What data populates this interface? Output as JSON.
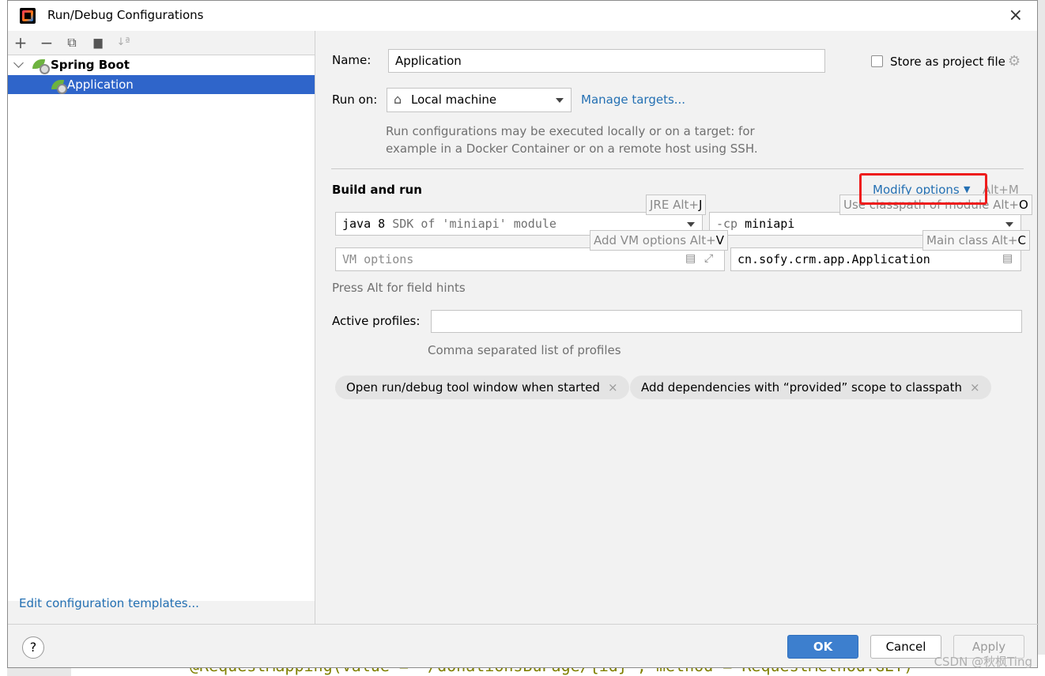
{
  "window": {
    "title": "Run/Debug Configurations",
    "close": "×"
  },
  "toolbar": {
    "add": "+",
    "remove": "−",
    "copy": "⧉",
    "folder": "▆",
    "sort": "↓ª"
  },
  "tree": {
    "group_label": "Spring Boot",
    "item_label": "Application"
  },
  "left_footer": {
    "edit_templates": "Edit configuration templates..."
  },
  "form": {
    "name_label": "Name:",
    "name_value": "Application",
    "store_label": "Store as project file",
    "run_on_label": "Run on:",
    "run_on_value": "Local machine",
    "manage_targets": "Manage targets...",
    "run_hint_line1": "Run configurations may be executed locally or on a target: for",
    "run_hint_line2": "example in a Docker Container or on a remote host using SSH.",
    "build_run_title": "Build and run",
    "modify_options": "Modify options",
    "modify_options_shortcut": "Alt+M",
    "jre_prefix": "java 8",
    "jre_suffix": "SDK of 'miniapi' module",
    "cp_prefix": "-cp",
    "cp_value": "miniapi",
    "vm_placeholder": "VM options",
    "main_class_value": "cn.sofy.crm.app.Application",
    "field_hint": "Press Alt for field hints",
    "active_profiles_label": "Active profiles:",
    "active_profiles_value": "",
    "profiles_hint": "Comma separated list of profiles"
  },
  "tooltips": {
    "jre": "JRE Alt+",
    "jre_key": "J",
    "classpath": "Use classpath of module Alt+",
    "classpath_key": "O",
    "vm": "Add VM options Alt+",
    "vm_key": "V",
    "main_class": "Main class Alt+",
    "main_class_key": "C"
  },
  "chips": [
    {
      "label": "Open run/debug tool window when started",
      "close": "×"
    },
    {
      "label": "Add dependencies with “provided” scope to classpath",
      "close": "×"
    }
  ],
  "footer": {
    "help": "?",
    "ok": "OK",
    "cancel": "Cancel",
    "apply": "Apply"
  },
  "background": {
    "code_snippet": "@RequestMapping(value = \"/donationsBuPage/{id}\", method = RequestMethod.GET)",
    "watermark": "CSDN @秋枫Ting"
  },
  "colors": {
    "accent": "#2f65ca",
    "link": "#2470b3",
    "highlight_box": "#ee1c1c",
    "ok_button": "#3d7fce"
  }
}
